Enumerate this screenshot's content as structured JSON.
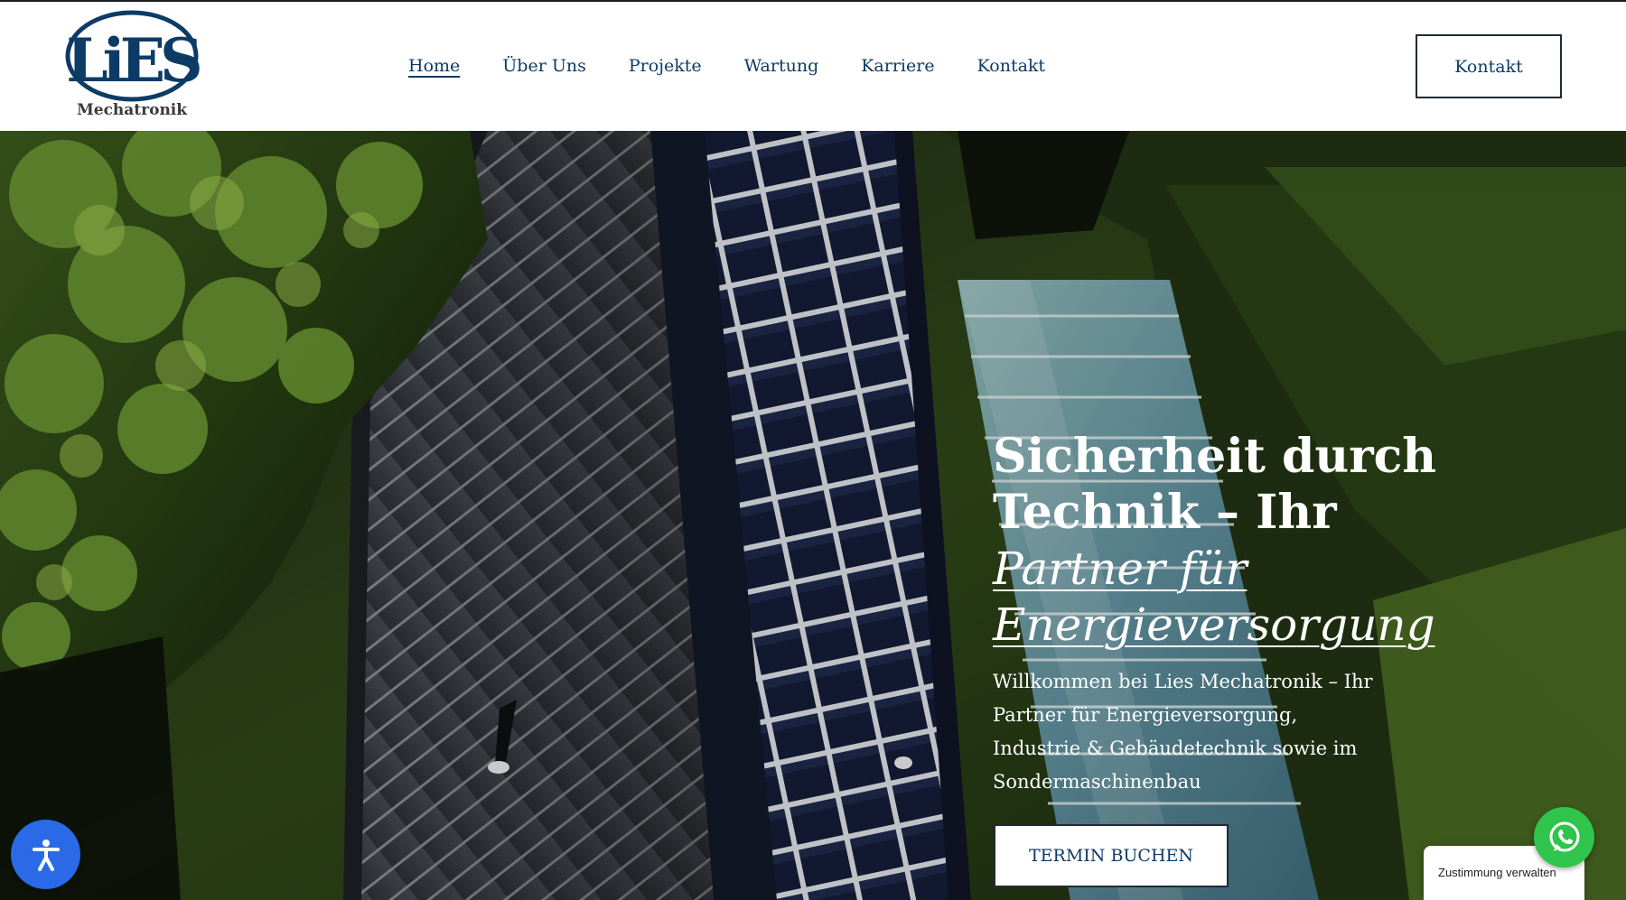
{
  "header": {
    "logo": {
      "letters": "LiES",
      "caption": "Mechatronik"
    },
    "nav": [
      {
        "label": "Home",
        "active": true
      },
      {
        "label": "Über Uns",
        "active": false
      },
      {
        "label": "Projekte",
        "active": false
      },
      {
        "label": "Wartung",
        "active": false
      },
      {
        "label": "Karriere",
        "active": false
      },
      {
        "label": "Kontakt",
        "active": false
      }
    ],
    "cta_label": "Kontakt"
  },
  "hero": {
    "title_line1": "Sicherheit durch",
    "title_line2": "Technik – Ihr",
    "title_italic_line1": "Partner für",
    "title_italic_line2": "Energieversorgung",
    "subtitle": "Willkommen bei Lies Mechatronik – Ihr Partner für Energieversorgung, Industrie & Gebäudetechnik sowie im Sondermaschinenbau",
    "cta_label": "TERMIN BUCHEN",
    "background": "aerial-photo-solar-roof-trees"
  },
  "widgets": {
    "accessibility_icon": "accessibility-person-icon",
    "consent_label": "Zustimmung verwalten",
    "whatsapp_icon": "whatsapp-icon"
  },
  "colors": {
    "brand_navy": "#0c3b66",
    "accessibility_blue": "#2a6ae6",
    "whatsapp_green": "#2fc44b"
  }
}
